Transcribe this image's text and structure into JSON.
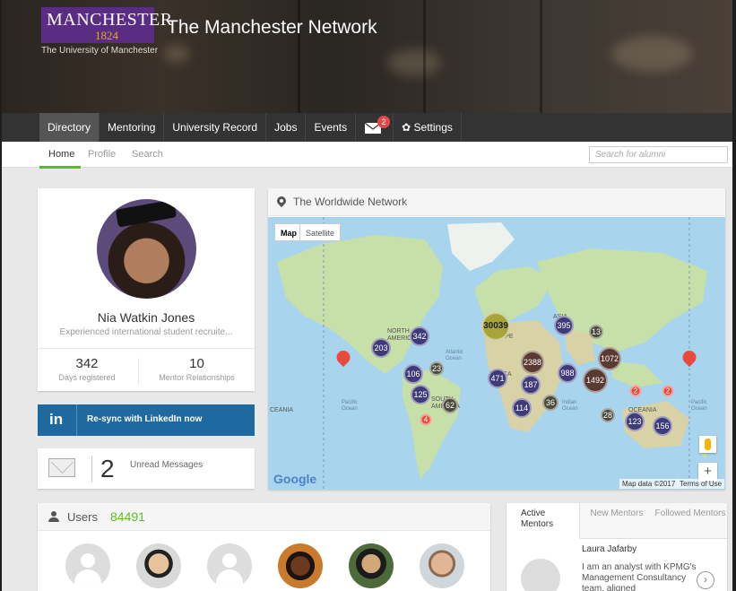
{
  "header": {
    "logo_word": "MANCHESTER",
    "logo_year": "1824",
    "university": "The University of Manchester",
    "site_title": "The Manchester Network"
  },
  "nav": {
    "items": [
      "Directory",
      "Mentoring",
      "University Record",
      "Jobs",
      "Events"
    ],
    "mail_badge": "2",
    "settings_label": "Settings"
  },
  "subnav": {
    "items": [
      "Home",
      "Profile",
      "Search"
    ],
    "search_placeholder": "Search for alumni"
  },
  "profile": {
    "name": "Nia Watkin Jones",
    "tagline": "Experienced international student recruite...",
    "days_value": "342",
    "days_label": "Days registered",
    "mentor_value": "10",
    "mentor_label": "Mentor Relationships"
  },
  "linkedin": {
    "icon_text": "in",
    "label": "Re-sync with LinkedIn now"
  },
  "messages": {
    "count": "2",
    "label": "Unread Messages"
  },
  "map": {
    "title": "The Worldwide Network",
    "type_map": "Map",
    "type_satellite": "Satellite",
    "attribution": "Map data ©2017",
    "terms": "Terms of Use",
    "google": "Google",
    "labels": {
      "north_america": "NORTH AMERICA",
      "europe": "EUROPE",
      "asia": "ASIA",
      "africa": "AFRICA",
      "south_america": "SOUTH AMERICA",
      "oceania": "OCEANIA",
      "oceania_left": "CEANIA",
      "atlantic": "Atlantic Ocean",
      "pacific_left": "Pacific Ocean",
      "pacific_right": "Pacific Ocean",
      "indian": "Indian Ocean"
    },
    "clusters": [
      "30039",
      "395",
      "13",
      "342",
      "203",
      "2388",
      "1072",
      "106",
      "23",
      "471",
      "187",
      "988",
      "1492",
      "125",
      "62",
      "36",
      "114",
      "28",
      "123",
      "156",
      "2",
      "2",
      "4"
    ],
    "zoom_in": "+",
    "zoom_out": "−",
    "accent_colors": {
      "big": "#a7a43a",
      "dark": "#3f3a7a",
      "brown": "#5b3a32",
      "red": "#e84a3d"
    }
  },
  "users": {
    "label": "Users",
    "count": "84491"
  },
  "mentors": {
    "tabs": [
      "Active Mentors",
      "New Mentors",
      "Followed Mentors"
    ],
    "name": "Laura Jafarby",
    "bio": "I am an analyst with KPMG's Management Consultancy team, aligned"
  },
  "colors": {
    "nav": "#333333",
    "accent_green": "#5dbb2a",
    "linkedin": "#1e6aa0",
    "brand_purple": "#5b2c83"
  }
}
